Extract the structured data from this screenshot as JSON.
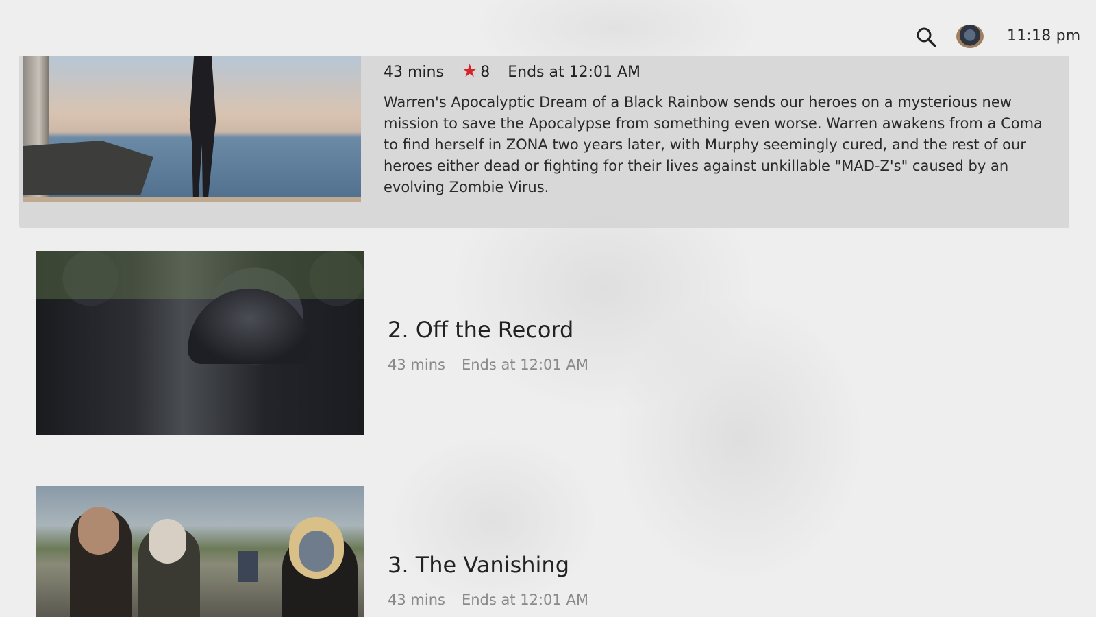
{
  "header": {
    "time": "11:18 pm",
    "search_icon": "search-icon",
    "avatar_icon": "user-avatar"
  },
  "selected_episode": {
    "duration": "43 mins",
    "rating": "8",
    "rating_icon": "star-icon",
    "rating_color": "#d8232a",
    "ends_at": "Ends at 12:01 AM",
    "description": "Warren's Apocalyptic Dream of a Black Rainbow sends our heroes on a mysterious new mission to save the Apocalypse from something even worse. Warren awakens from a Coma to find herself in ZONA two years later, with Murphy seemingly cured, and the rest of our heroes either dead or fighting for their lives against unkillable \"MAD-Z's\" caused by an evolving Zombie Virus."
  },
  "episodes": [
    {
      "title": "2. Off the Record",
      "duration": "43 mins",
      "ends_at": "Ends at 12:01 AM"
    },
    {
      "title": "3. The Vanishing",
      "duration": "43 mins",
      "ends_at": "Ends at 12:01 AM"
    }
  ]
}
